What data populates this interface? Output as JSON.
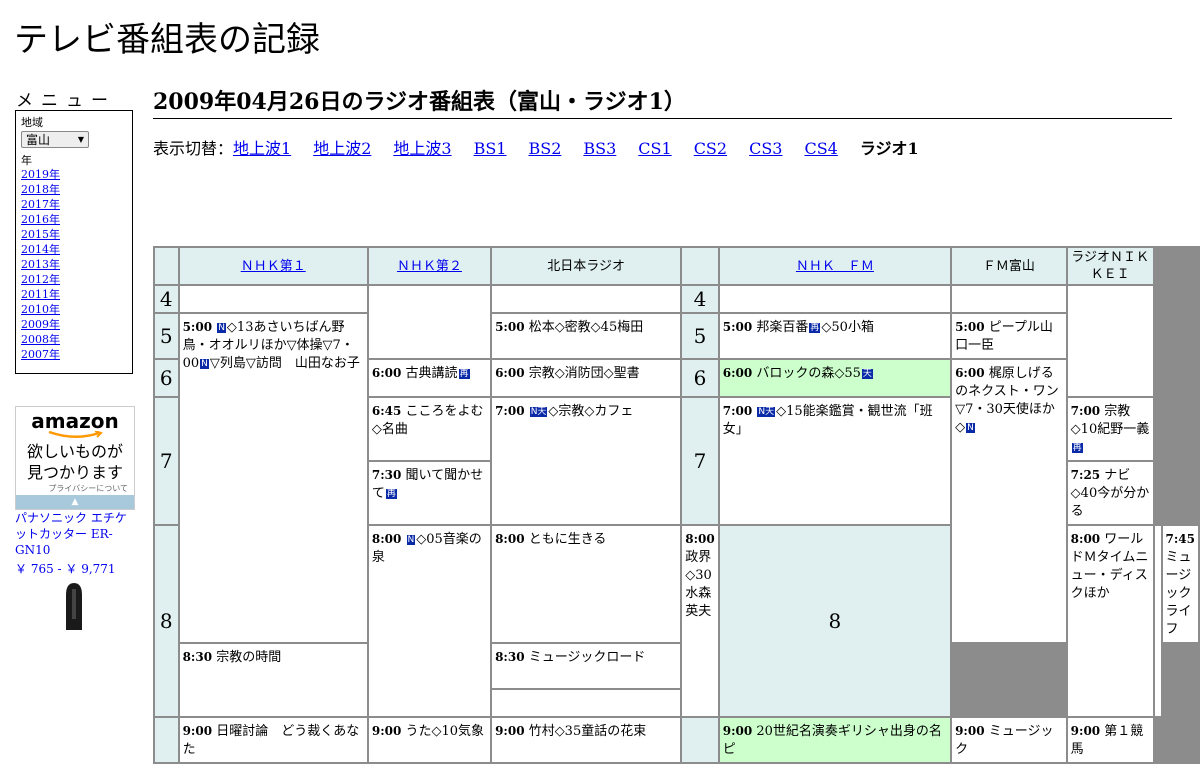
{
  "site": {
    "title": "テレビ番組表の記録"
  },
  "menu": {
    "heading": "メニュー",
    "region_label": "地域",
    "region_value": "富山",
    "year_label": "年",
    "years": [
      "2019年",
      "2018年",
      "2017年",
      "2016年",
      "2015年",
      "2014年",
      "2013年",
      "2012年",
      "2011年",
      "2010年",
      "2009年",
      "2008年",
      "2007年"
    ]
  },
  "ad": {
    "logo": "amazon",
    "line1": "欲しいものが",
    "line2": "見つかります",
    "privacy": "プライバシーについて",
    "product_name": "パナソニック エチケットカッター ER-GN10",
    "product_price": "￥ 765 - ￥ 9,771"
  },
  "page": {
    "heading": "2009年04月26日のラジオ番組表（富山・ラジオ1）"
  },
  "switcher": {
    "label": "表示切替：",
    "links": [
      "地上波1",
      "地上波2",
      "地上波3",
      "BS1",
      "BS2",
      "BS3",
      "CS1",
      "CS2",
      "CS3",
      "CS4"
    ],
    "current": "ラジオ1"
  },
  "schedule": {
    "channels": [
      "ＮＨＫ第１",
      "ＮＨＫ第２",
      "北日本ラジオ",
      "ＮＨＫ　ＦＭ",
      "ＦＭ富山",
      "ラジオＮＩＫＫＥＩ"
    ],
    "hours": [
      "4",
      "5",
      "6",
      "7",
      "8"
    ],
    "badges": {
      "news": "N",
      "weather": "天",
      "re": "再",
      "news_weather": "N天"
    },
    "programs": {
      "nhk1_5": {
        "time": "5:00",
        "a": "◇13あさいちばん野鳥・オオルリほか▽体操▽7・00",
        "b": "▽列島▽訪問　山田なお子"
      },
      "nhk1_8": {
        "time": "8:00",
        "title": "◇05音楽の泉"
      },
      "nhk1_9": {
        "time": "9:00",
        "title": "日曜討論　どう裁くあなた"
      },
      "nhk2_6": {
        "time": "6:00",
        "title": "古典講読"
      },
      "nhk2_645": {
        "time": "6:45",
        "title": "こころをよむ◇名曲"
      },
      "nhk2_730": {
        "time": "7:30",
        "title": "聞いて聞かせて"
      },
      "nhk2_8": {
        "time": "8:00",
        "title": "ともに生きる"
      },
      "nhk2_830": {
        "time": "8:30",
        "title": "宗教の時間"
      },
      "nhk2_9": {
        "time": "9:00",
        "title": "うた◇10気象"
      },
      "kita_5": {
        "time": "5:00",
        "title": "松本◇密教◇45梅田"
      },
      "kita_6": {
        "time": "6:00",
        "title": "宗教◇消防団◇聖書"
      },
      "kita_7": {
        "time": "7:00",
        "title": "◇宗教◇カフェ"
      },
      "kita_8": {
        "time": "8:00",
        "title": "政界◇30水森英夫"
      },
      "kita_9": {
        "time": "9:00",
        "title": "竹村◇35童話の花束"
      },
      "fm_5": {
        "time": "5:00",
        "a": "邦楽百番",
        "b": "◇50小箱"
      },
      "fm_6": {
        "time": "6:00",
        "title": "バロックの森◇55"
      },
      "fm_7": {
        "time": "7:00",
        "title": "◇15能楽鑑賞・観世流「班女」"
      },
      "fm_8": {
        "time": "8:00",
        "title": "ワールドＭタイムニュー・ディスクほか"
      },
      "fm_9": {
        "time": "9:00",
        "title": "20世紀名演奏ギリシャ出身の名ピ"
      },
      "fmt_5": {
        "time": "5:00",
        "title": "ピープル山口一臣"
      },
      "fmt_6": {
        "time": "6:00",
        "title": "梶原しげるのネクスト・ワン▽7・30天使ほか◇"
      },
      "fmt_9": {
        "time": "9:00",
        "title": "ミュージック"
      },
      "nik_7": {
        "time": "7:00",
        "title": "宗教◇10紀野一義"
      },
      "nik_725": {
        "time": "7:25",
        "title": "ナビ◇40今が分かる"
      },
      "nik_745": {
        "time": "7:45",
        "title": "ミュージックライフ"
      },
      "nik_830": {
        "time": "8:30",
        "title": "ミュージックロード"
      },
      "nik_9": {
        "time": "9:00",
        "title": "第１競馬"
      }
    }
  }
}
